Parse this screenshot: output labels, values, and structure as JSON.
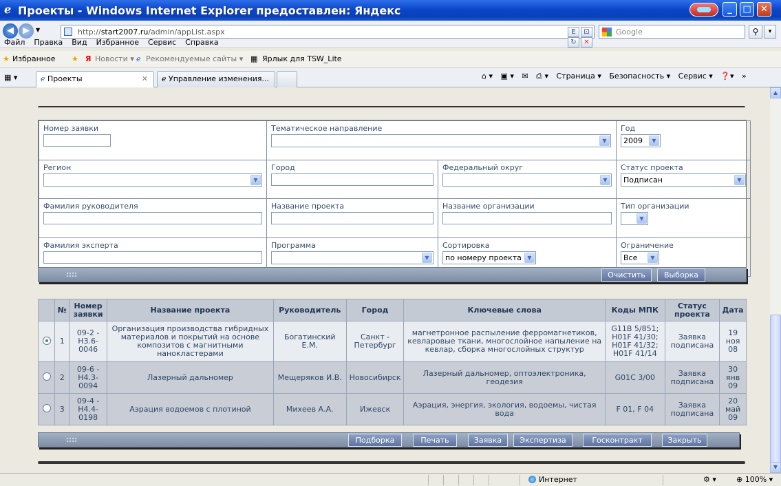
{
  "window": {
    "title": "Проекты - Windows Internet Explorer предоставлен: Яндекс"
  },
  "nav": {
    "url_prefix": "http://",
    "url_host": "start2007.ru",
    "url_path": "/admin/appList.aspx",
    "search_placeholder": "Google"
  },
  "menu": [
    "Файл",
    "Правка",
    "Вид",
    "Избранное",
    "Сервис",
    "Справка"
  ],
  "favorites": {
    "label": "Избранное",
    "news": "Новости ▾",
    "recommended": "Рекомендуемые сайты ▾",
    "shortcut": "Ярлык для TSW_Lite"
  },
  "tabs": [
    {
      "label": "Проекты"
    },
    {
      "label": "Управление изменения..."
    }
  ],
  "command_bar": {
    "page": "Страница ▾",
    "security": "Безопасность ▾",
    "service": "Сервис ▾"
  },
  "filter": {
    "app_no_label": "Номер заявки",
    "theme_label": "Тематическое направление",
    "year_label": "Год",
    "year_value": "2009",
    "region_label": "Регион",
    "city_label": "Город",
    "fed_district_label": "Федеральный округ",
    "project_status_label": "Статус проекта",
    "project_status_value": "Подписан",
    "leader_label": "Фамилия руководителя",
    "project_name_label": "Название проекта",
    "org_name_label": "Название организации",
    "org_type_label": "Тип организации",
    "expert_label": "Фамилия эксперта",
    "program_label": "Программа",
    "sort_label": "Сортировка",
    "sort_value": "по номеру проекта",
    "limit_label": "Ограничение",
    "limit_value": "Все"
  },
  "top_buttons": {
    "clear": "Очистить",
    "select": "Выборка"
  },
  "table": {
    "headers": [
      "№",
      "Номер заявки",
      "Название проекта",
      "Руководитель",
      "Город",
      "Ключевые слова",
      "Коды МПК",
      "Статус проекта",
      "Дата"
    ],
    "rows": [
      {
        "no": "1",
        "app": "09-2 - Н3.6-0046",
        "name": "Организация производства гибридных материалов и покрытий на основе композитов с магнитными нанокластерами",
        "leader": "Богатинский Е.М.",
        "city": "Санкт - Петербург",
        "keywords": "магнетронное распыление ферромагнетиков, кевларовые ткани, многослойное напыление на кевлар, сборка многослойных структур",
        "codes": "G11B 5/851; H01F 41/30; H01F 41/32; H01F 41/14",
        "status": "Заявка подписана",
        "date": "19 ноя 08",
        "selected": true
      },
      {
        "no": "2",
        "app": "09-6 - Н4.3-0094",
        "name": "Лазерный дальномер",
        "leader": "Мещеряков И.В.",
        "city": "Новосибирск",
        "keywords": "Лазерный дальномер, оптоэлектроника, геодезия",
        "codes": "G01C 3/00",
        "status": "Заявка подписана",
        "date": "30 янв 09",
        "selected": false
      },
      {
        "no": "3",
        "app": "09-4 - Н4.4-0198",
        "name": "Аэрация водоемов с плотиной",
        "leader": "Михеев А.А.",
        "city": "Ижевск",
        "keywords": "Аэрация, энергия, экология, водоемы, чистая вода",
        "codes": "F 01, F 04",
        "status": "Заявка подписана",
        "date": "20 май 09",
        "selected": false
      }
    ]
  },
  "bottom_buttons": {
    "pick": "Подборка",
    "print": "Печать",
    "application": "Заявка",
    "expertise": "Экспертиза",
    "contract": "Госконтракт",
    "close": "Закрыть"
  },
  "statusbar": {
    "zone": "Интернет",
    "zoom": "100%"
  }
}
